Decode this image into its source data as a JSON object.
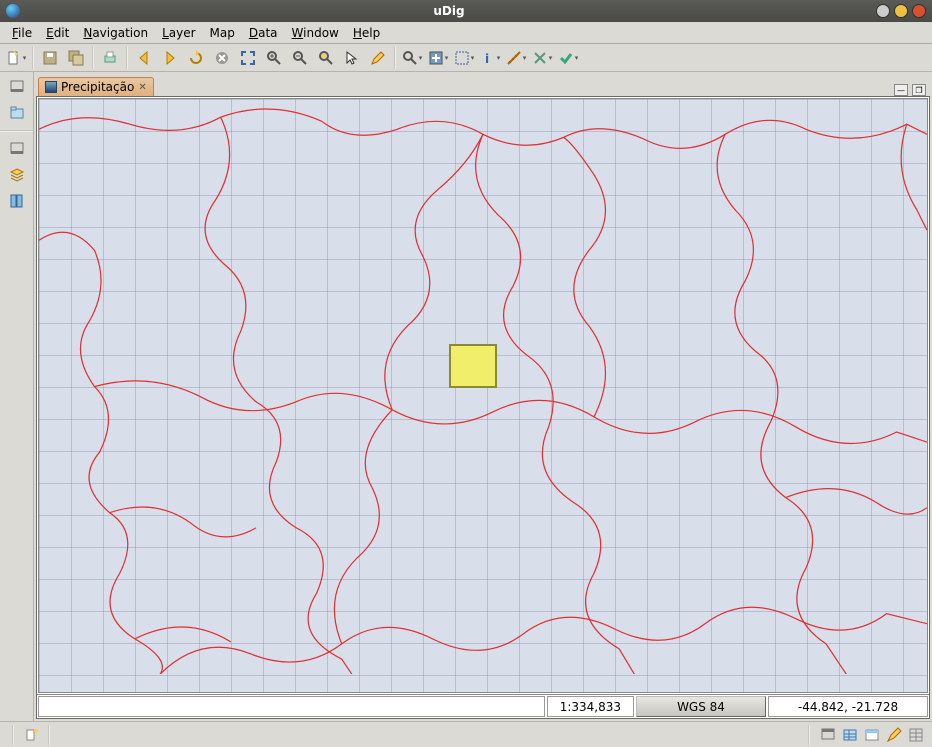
{
  "window": {
    "title": "uDig"
  },
  "menu": {
    "file": "File",
    "edit": "Edit",
    "navigation": "Navigation",
    "layer": "Layer",
    "map": "Map",
    "data": "Data",
    "window": "Window",
    "help": "Help"
  },
  "toolbar_icons": {
    "new": "new-file-icon",
    "save1": "save-icon",
    "save2": "save-all-icon",
    "print": "print-icon",
    "back": "back-arrow-icon",
    "forward": "forward-arrow-icon",
    "refresh": "refresh-icon",
    "stop": "cancel-icon",
    "extent": "zoom-extent-icon",
    "zoomin": "zoom-in-icon",
    "zoomout": "zoom-out-icon",
    "zoomsel": "zoom-selection-icon",
    "cursor": "cursor-icon",
    "edit": "edit-icon",
    "search": "search-icon",
    "pan": "pan-icon",
    "select": "select-box-icon",
    "info": "info-icon",
    "measure": "measure-icon",
    "split": "split-icon",
    "commit": "commit-icon"
  },
  "sidepanel_icons": {
    "min1": "minimize-icon",
    "projects": "projects-view-icon",
    "min2": "minimize-icon",
    "layers": "layers-view-icon",
    "catalog": "catalog-view-icon"
  },
  "tab": {
    "label": "Precipitação"
  },
  "status": {
    "scale": "1:334,833",
    "crs": "WGS 84",
    "coords": "-44.842, -21.728"
  },
  "bottombar_icons": {
    "wizard": "wizard-icon",
    "restore": "restore-view-icon",
    "table": "table-view-icon",
    "outline": "outline-view-icon",
    "style": "style-view-icon",
    "props": "properties-view-icon"
  }
}
